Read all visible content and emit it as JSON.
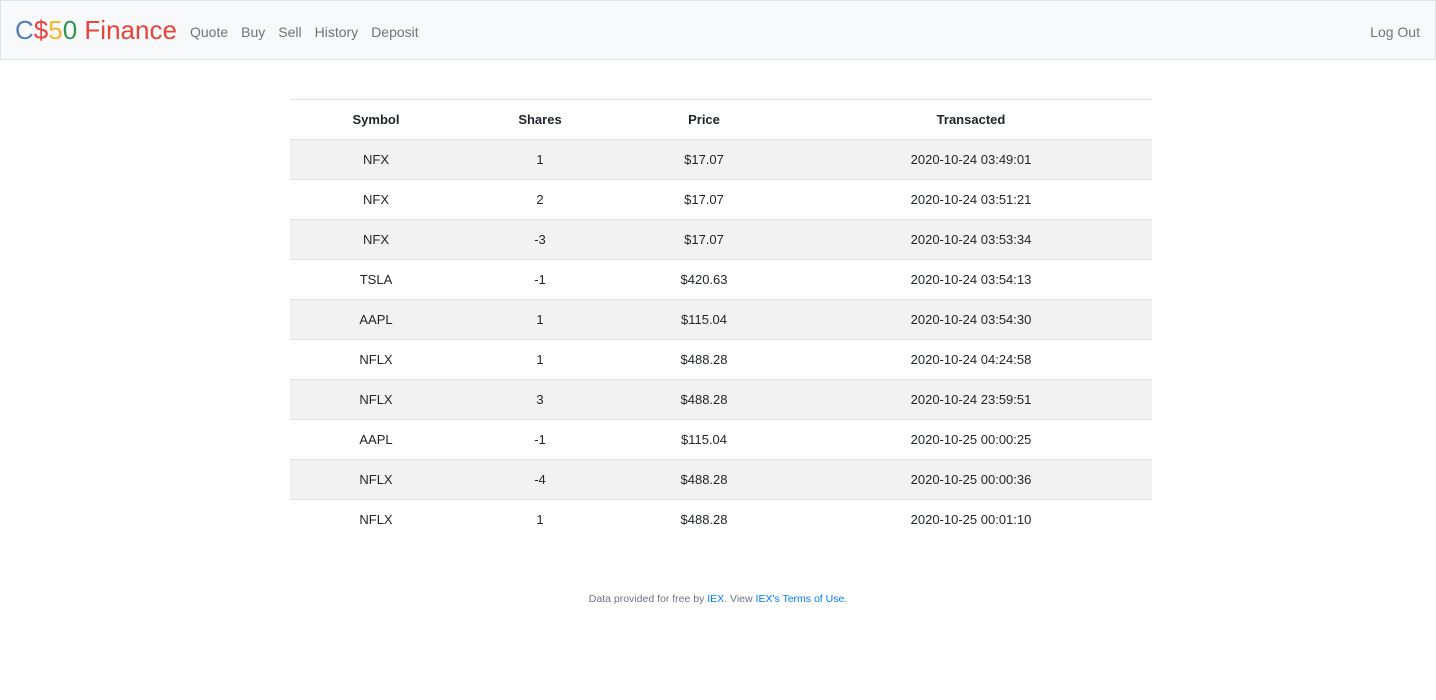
{
  "navbar": {
    "brand": {
      "parts": [
        {
          "text": "C",
          "color": "#537fbe"
        },
        {
          "text": "$",
          "color": "#ea433b"
        },
        {
          "text": "5",
          "color": "#f5b82e"
        },
        {
          "text": "0",
          "color": "#2e944b"
        },
        {
          "text": " Finance",
          "color": "#ea433b"
        }
      ]
    },
    "links": [
      "Quote",
      "Buy",
      "Sell",
      "History",
      "Deposit"
    ],
    "logout": "Log Out"
  },
  "history_table": {
    "headers": [
      "Symbol",
      "Shares",
      "Price",
      "Transacted"
    ],
    "rows": [
      [
        "NFX",
        "1",
        "$17.07",
        "2020-10-24 03:49:01"
      ],
      [
        "NFX",
        "2",
        "$17.07",
        "2020-10-24 03:51:21"
      ],
      [
        "NFX",
        "-3",
        "$17.07",
        "2020-10-24 03:53:34"
      ],
      [
        "TSLA",
        "-1",
        "$420.63",
        "2020-10-24 03:54:13"
      ],
      [
        "AAPL",
        "1",
        "$115.04",
        "2020-10-24 03:54:30"
      ],
      [
        "NFLX",
        "1",
        "$488.28",
        "2020-10-24 04:24:58"
      ],
      [
        "NFLX",
        "3",
        "$488.28",
        "2020-10-24 23:59:51"
      ],
      [
        "AAPL",
        "-1",
        "$115.04",
        "2020-10-25 00:00:25"
      ],
      [
        "NFLX",
        "-4",
        "$488.28",
        "2020-10-25 00:00:36"
      ],
      [
        "NFLX",
        "1",
        "$488.28",
        "2020-10-25 00:01:10"
      ]
    ]
  },
  "footer": {
    "prefix": "Data provided for free by ",
    "iex_link": "IEX",
    "middle": ". View ",
    "terms_link": "IEX's Terms of Use",
    "suffix": "."
  }
}
